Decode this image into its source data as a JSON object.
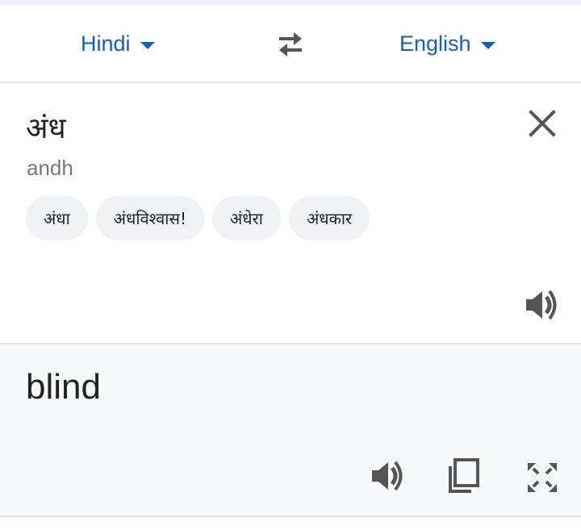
{
  "language_bar": {
    "source_language": "Hindi",
    "target_language": "English",
    "swap_icon": "swap-arrows-icon",
    "accent_color": "#1a5fb4"
  },
  "source_panel": {
    "text": "अंध",
    "transliteration": "andh",
    "clear_icon": "close-icon",
    "speak_icon": "speaker-icon",
    "suggestions": [
      "अंधा",
      "अंधविश्वास!",
      "अंधेरा",
      "अंधकार"
    ]
  },
  "target_panel": {
    "text": "blind",
    "icons": [
      "speaker-icon",
      "copy-icon",
      "fullscreen-icon"
    ]
  }
}
